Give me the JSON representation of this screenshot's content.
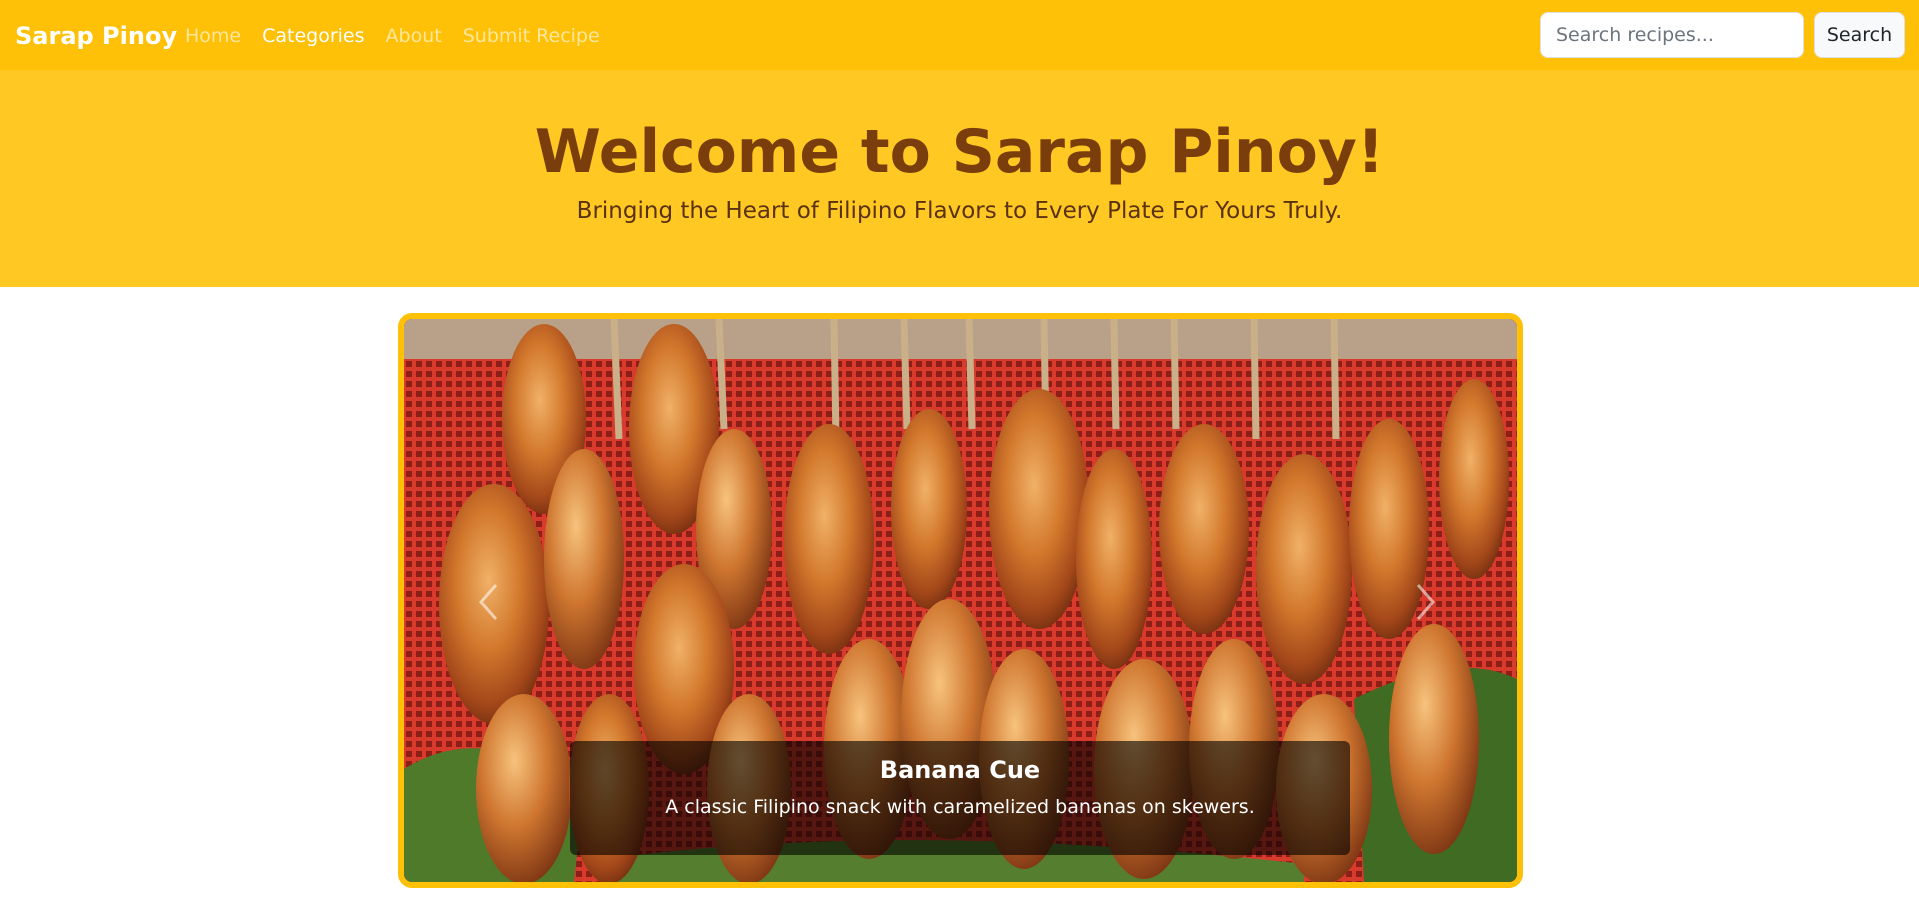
{
  "navbar": {
    "brand": "Sarap Pinoy",
    "links": [
      {
        "label": "Home",
        "active": false
      },
      {
        "label": "Categories",
        "active": true
      },
      {
        "label": "About",
        "active": false
      },
      {
        "label": "Submit Recipe",
        "active": false
      }
    ],
    "search": {
      "placeholder": "Search recipes...",
      "value": "",
      "button_label": "Search"
    }
  },
  "hero": {
    "title": "Welcome to Sarap Pinoy!",
    "subtitle": "Bringing the Heart of Filipino Flavors to Every Plate For Yours Truly."
  },
  "carousel": {
    "slide": {
      "title": "Banana Cue",
      "description": "A classic Filipino snack with caramelized bananas on skewers."
    },
    "prev_icon": "chevron-left-icon",
    "next_icon": "chevron-right-icon"
  },
  "colors": {
    "navbar": "#ffc107",
    "hero": "#ffc823",
    "hero_title": "#7a3e0d",
    "carousel_border": "#ffc107"
  }
}
